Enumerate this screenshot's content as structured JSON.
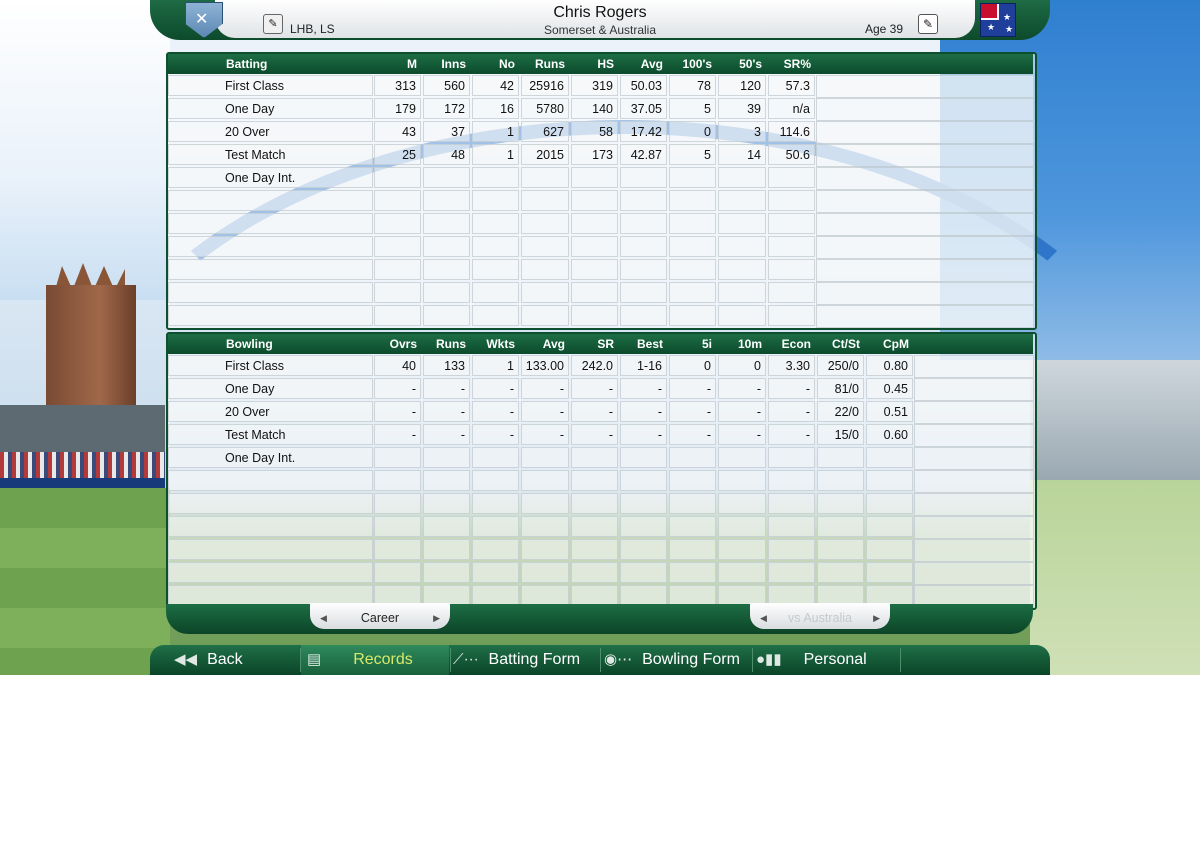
{
  "header": {
    "player_name": "Chris Rogers",
    "team": "Somerset & Australia",
    "handedness": "LHB, LS",
    "age": "Age 39",
    "icons": {
      "badge": "cricket-badge-icon",
      "hand": "batting-hand-icon",
      "edit": "edit-pencil-icon",
      "flag": "australia-flag-icon"
    }
  },
  "batting": {
    "columns": [
      "Batting",
      "M",
      "Inns",
      "No",
      "Runs",
      "HS",
      "Avg",
      "100's",
      "50's",
      "SR%"
    ],
    "rows": [
      {
        "label": "First Class",
        "values": [
          "313",
          "560",
          "42",
          "25916",
          "319",
          "50.03",
          "78",
          "120",
          "57.3"
        ]
      },
      {
        "label": "One Day",
        "values": [
          "179",
          "172",
          "16",
          "5780",
          "140",
          "37.05",
          "5",
          "39",
          "n/a"
        ]
      },
      {
        "label": "20 Over",
        "values": [
          "43",
          "37",
          "1",
          "627",
          "58",
          "17.42",
          "0",
          "3",
          "114.6"
        ]
      },
      {
        "label": "Test Match",
        "values": [
          "25",
          "48",
          "1",
          "2015",
          "173",
          "42.87",
          "5",
          "14",
          "50.6"
        ]
      },
      {
        "label": "One Day Int.",
        "values": [
          "",
          "",
          "",
          "",
          "",
          "",
          "",
          "",
          ""
        ]
      }
    ]
  },
  "bowling": {
    "columns": [
      "Bowling",
      "Ovrs",
      "Runs",
      "Wkts",
      "Avg",
      "SR",
      "Best",
      "5i",
      "10m",
      "Econ",
      "Ct/St",
      "CpM"
    ],
    "rows": [
      {
        "label": "First Class",
        "values": [
          "40",
          "133",
          "1",
          "133.00",
          "242.0",
          "1-16",
          "0",
          "0",
          "3.30",
          "250/0",
          "0.80"
        ]
      },
      {
        "label": "One Day",
        "values": [
          "-",
          "-",
          "-",
          "-",
          "-",
          "-",
          "-",
          "-",
          "-",
          "81/0",
          "0.45"
        ]
      },
      {
        "label": "20 Over",
        "values": [
          "-",
          "-",
          "-",
          "-",
          "-",
          "-",
          "-",
          "-",
          "-",
          "22/0",
          "0.51"
        ]
      },
      {
        "label": "Test Match",
        "values": [
          "-",
          "-",
          "-",
          "-",
          "-",
          "-",
          "-",
          "-",
          "-",
          "15/0",
          "0.60"
        ]
      },
      {
        "label": "One Day Int.",
        "values": [
          "",
          "",
          "",
          "",
          "",
          "",
          "",
          "",
          "",
          "",
          ""
        ]
      }
    ]
  },
  "tabs": {
    "left": "Career",
    "right": "vs Australia"
  },
  "nav": {
    "back": "Back",
    "records": "Records",
    "batting_form": "Batting Form",
    "bowling_form": "Bowling Form",
    "personal": "Personal"
  },
  "colors": {
    "accent_green": "#0d4f2e",
    "active_text": "#d7e86a"
  }
}
